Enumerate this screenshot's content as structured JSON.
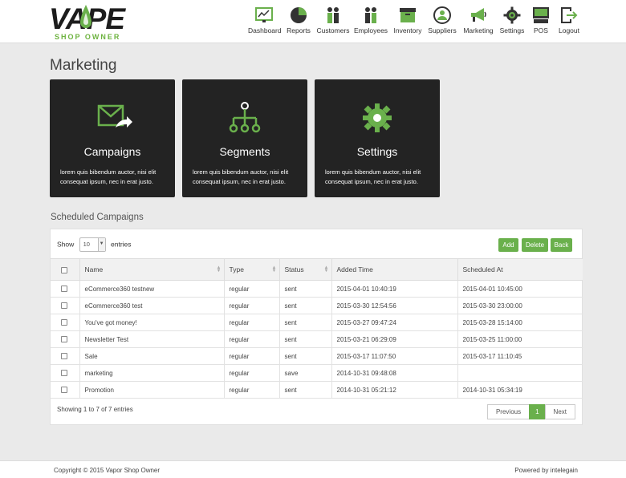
{
  "brand": {
    "name": "VAPE",
    "subtitle": "SHOP OWNER",
    "accent": "#6ab04c",
    "dark": "#232323"
  },
  "nav": [
    {
      "label": "Dashboard",
      "icon": "dashboard-icon"
    },
    {
      "label": "Reports",
      "icon": "pie-chart-icon"
    },
    {
      "label": "Customers",
      "icon": "customers-icon"
    },
    {
      "label": "Employees",
      "icon": "employees-icon"
    },
    {
      "label": "Inventory",
      "icon": "inventory-box-icon"
    },
    {
      "label": "Suppliers",
      "icon": "supplier-icon"
    },
    {
      "label": "Marketing",
      "icon": "megaphone-icon"
    },
    {
      "label": "Settings",
      "icon": "gear-icon"
    },
    {
      "label": "POS",
      "icon": "register-icon"
    },
    {
      "label": "Logout",
      "icon": "logout-icon"
    }
  ],
  "page": {
    "title": "Marketing"
  },
  "tiles": [
    {
      "title": "Campaigns",
      "desc": "lorem quis bibendum auctor, nisi elit consequat ipsum, nec in erat justo.",
      "icon": "envelope-send-icon"
    },
    {
      "title": "Segments",
      "desc": "lorem quis bibendum auctor, nisi elit consequat ipsum, nec in erat justo.",
      "icon": "hierarchy-icon"
    },
    {
      "title": "Settings",
      "desc": "lorem quis bibendum auctor, nisi elit consequat ipsum, nec in erat justo.",
      "icon": "gear-icon"
    }
  ],
  "scheduled": {
    "title": "Scheduled Campaigns",
    "show_label": "Show",
    "entries_label": "entries",
    "page_size": "10",
    "buttons": {
      "add": "Add",
      "delete": "Delete",
      "back": "Back"
    },
    "columns": [
      "Name",
      "Type",
      "Status",
      "Added Time",
      "Scheduled At"
    ],
    "rows": [
      [
        "eCommerce360 testnew",
        "regular",
        "sent",
        "2015-04-01 10:40:19",
        "2015-04-01 10:45:00"
      ],
      [
        "eCommerce360 test",
        "regular",
        "sent",
        "2015-03-30 12:54:56",
        "2015-03-30 23:00:00"
      ],
      [
        "You've got money!",
        "regular",
        "sent",
        "2015-03-27 09:47:24",
        "2015-03-28 15:14:00"
      ],
      [
        "Newsletter Test",
        "regular",
        "sent",
        "2015-03-21 06:29:09",
        "2015-03-25 11:00:00"
      ],
      [
        "Sale",
        "regular",
        "sent",
        "2015-03-17 11:07:50",
        "2015-03-17 11:10:45"
      ],
      [
        "marketing",
        "regular",
        "save",
        "2014-10-31 09:48:08",
        ""
      ],
      [
        "Promotion",
        "regular",
        "sent",
        "2014-10-31 05:21:12",
        "2014-10-31 05:34:19"
      ]
    ],
    "info": "Showing 1 to 7 of 7 entries",
    "pager": {
      "prev": "Previous",
      "current": "1",
      "next": "Next"
    }
  },
  "footer": {
    "copyright": "Copyright © 2015 Vapor Shop Owner",
    "powered": "Powered by intelegain"
  }
}
